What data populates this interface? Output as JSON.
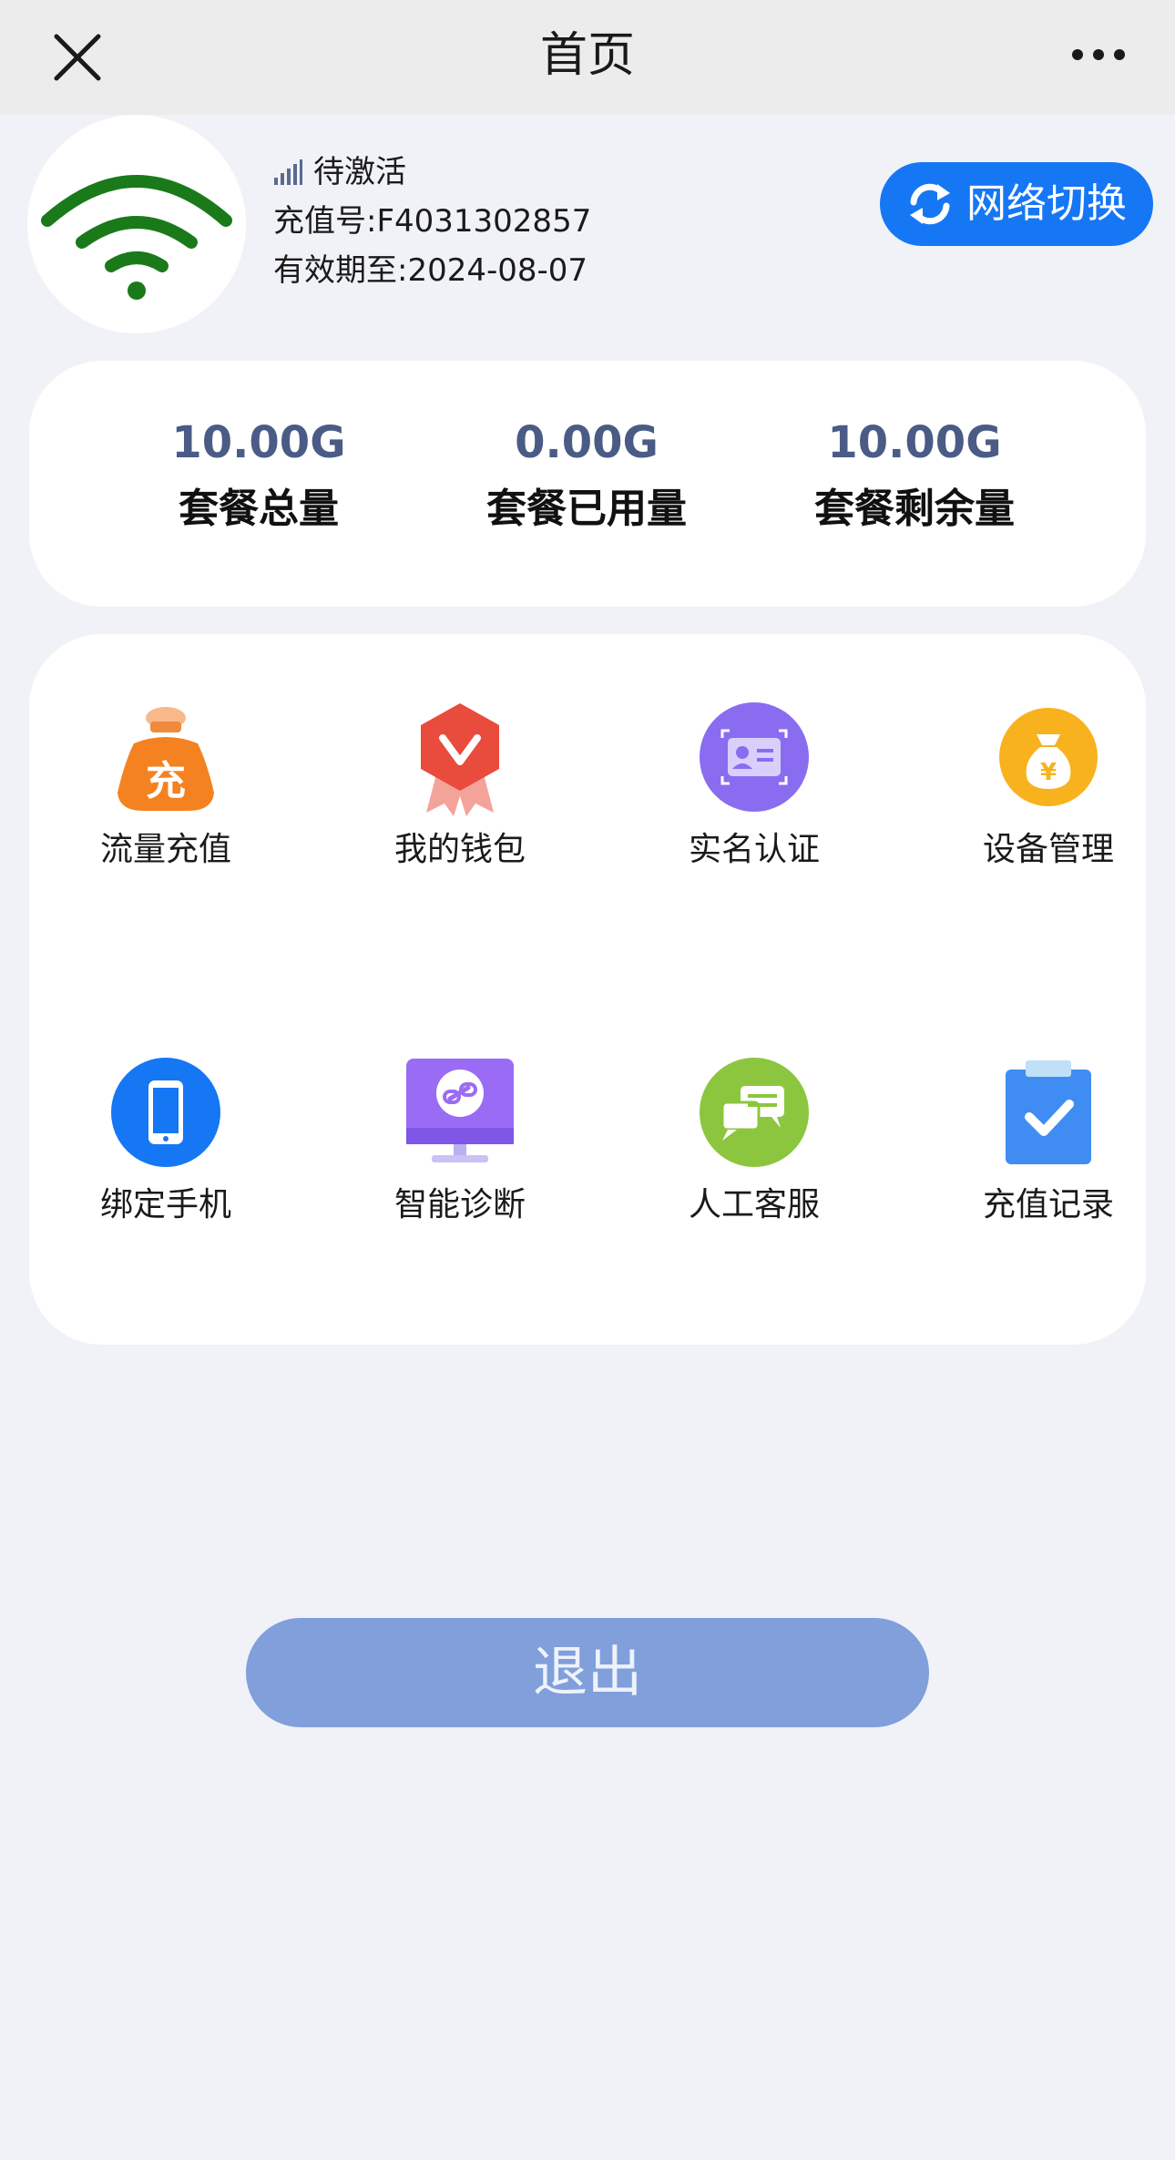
{
  "navbar": {
    "title": "首页",
    "close_icon": "close-icon",
    "more_icon": "more-icon"
  },
  "device": {
    "status": "待激活",
    "recharge_no": "充值号:F4031302857",
    "valid_until": "有效期至:2024-08-07",
    "wifi_color": "#1a7a1a"
  },
  "switch_button": {
    "label": "网络切换",
    "accent": "#1677f5"
  },
  "stats": [
    {
      "value": "10.00G",
      "label": "套餐总量"
    },
    {
      "value": "0.00G",
      "label": "套餐已用量"
    },
    {
      "value": "10.00G",
      "label": "套餐剩余量"
    }
  ],
  "menu": [
    {
      "label": "流量充值",
      "icon": "money-bag-recharge-icon"
    },
    {
      "label": "我的钱包",
      "icon": "wallet-badge-icon"
    },
    {
      "label": "实名认证",
      "icon": "id-card-icon"
    },
    {
      "label": "设备管理",
      "icon": "coin-bag-icon"
    },
    {
      "label": "绑定手机",
      "icon": "phone-icon"
    },
    {
      "label": "智能诊断",
      "icon": "monitor-link-icon"
    },
    {
      "label": "人工客服",
      "icon": "chat-bubbles-icon"
    },
    {
      "label": "充值记录",
      "icon": "clipboard-check-icon"
    }
  ],
  "logout": {
    "label": "退出"
  }
}
